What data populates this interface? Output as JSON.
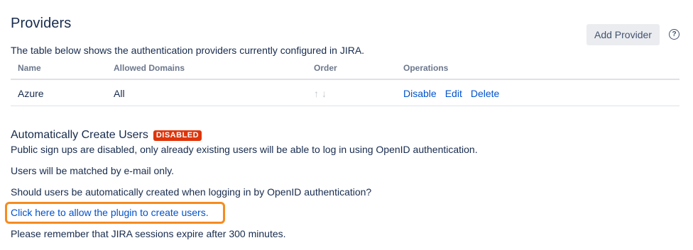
{
  "header": {
    "title": "Providers",
    "add_button_label": "Add Provider",
    "help_icon": "?",
    "description": "The table below shows the authentication providers currently configured in JIRA."
  },
  "table": {
    "columns": [
      "Name",
      "Allowed Domains",
      "Order",
      "Operations"
    ],
    "rows": [
      {
        "name": "Azure",
        "allowed_domains": "All",
        "order_arrows": "↑↓",
        "operations": [
          "Disable",
          "Edit",
          "Delete"
        ]
      }
    ]
  },
  "auto_create": {
    "title": "Automatically Create Users",
    "badge": "DISABLED",
    "status_text": "Public sign ups are disabled, only already existing users will be able to log in using OpenID authentication.",
    "match_text": "Users will be matched by e-mail only.",
    "question_text": "Should users be automatically created when logging in by OpenID authentication?",
    "link_text": "Click here to allow the plugin to create users.",
    "session_text": "Please remember that JIRA sessions expire after 300 minutes."
  },
  "colors": {
    "link": "#0052cc",
    "badge": "#de350b",
    "highlight": "#f68b1f",
    "text": "#172b4d"
  }
}
